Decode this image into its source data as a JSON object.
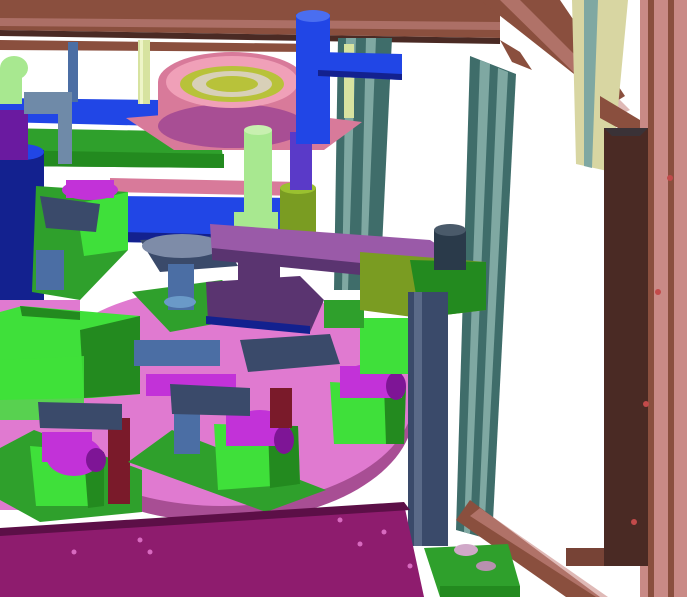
{
  "scene": {
    "palette": {
      "background": "#ffffff",
      "frame_brown": "#8a4f3e",
      "frame_pink": "#c98a86",
      "frame_dark_brown": "#4a2a24",
      "extrusion_teal": "#3f6d6a",
      "extrusion_light": "#7fa8a2",
      "extrusion_tan": "#d8d6a2",
      "turntable_pink": "#e07ad0",
      "turntable_edge": "#a84e94",
      "base_magenta": "#8e1c6e",
      "base_magenta_dark": "#5c0f47",
      "fixture_green": "#3fe03a",
      "fixture_green_dark": "#238a1f",
      "plate_green": "#2fa02c",
      "motor_purple": "#c232d8",
      "motor_purple_dark": "#7e1596",
      "blue_cylinder": "#2146e6",
      "navy": "#13218f",
      "olive_green": "#7a9c22",
      "mauve_arm": "#9a5aa8",
      "mauve_dark": "#5a3470",
      "steel_blue": "#4b6ea4",
      "grey_blue": "#6f8aa8",
      "dark_slate": "#3a4a6a",
      "pale_green": "#a8e890",
      "salmon_pink": "#d87a9a",
      "steel_dark": "#2a3a4a"
    }
  }
}
